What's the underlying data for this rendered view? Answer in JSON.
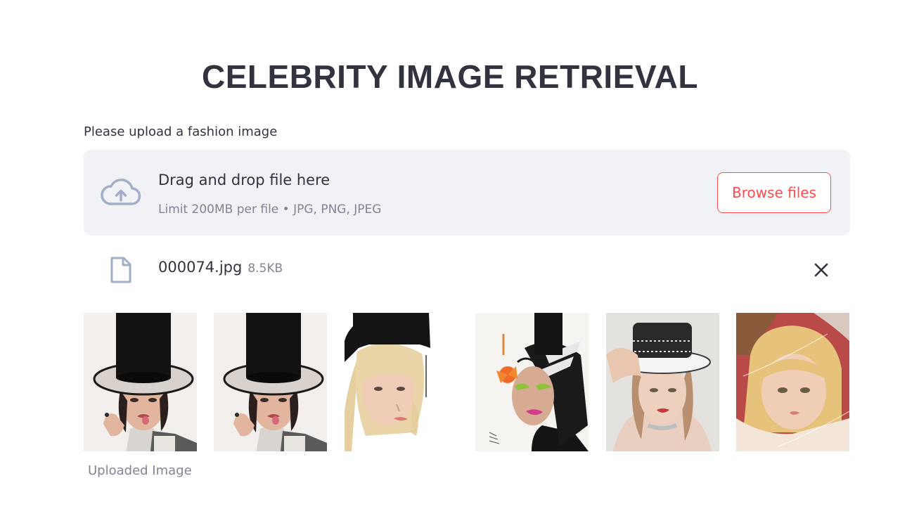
{
  "page": {
    "title": "CELEBRITY IMAGE RETRIEVAL"
  },
  "uploader": {
    "label": "Please upload a fashion image",
    "dropzone_text": "Drag and drop file here",
    "limits_text": "Limit 200MB per file • JPG, PNG, JPEG",
    "browse_label": "Browse files",
    "cloud_icon": "cloud-upload-icon"
  },
  "uploaded_file": {
    "name": "000074.jpg",
    "size": "8.5KB",
    "file_icon": "file-icon",
    "remove_icon": "close-icon"
  },
  "results": {
    "caption": "Uploaded Image",
    "images": [
      {
        "subject": "woman in black top hat sticking out tongue"
      },
      {
        "subject": "woman in black top hat sticking out tongue"
      },
      {
        "subject": "blonde woman in black top hat"
      },
      {
        "subject": "woman with green eyeshadow and flower"
      },
      {
        "subject": "woman in white top hat"
      },
      {
        "subject": "young girl with blonde hair"
      }
    ]
  },
  "colors": {
    "accent": "#ff4b4b",
    "dropzone_bg": "#f0f2f6",
    "text": "#31333f",
    "muted": "#808495",
    "icon": "#a3aec9"
  }
}
